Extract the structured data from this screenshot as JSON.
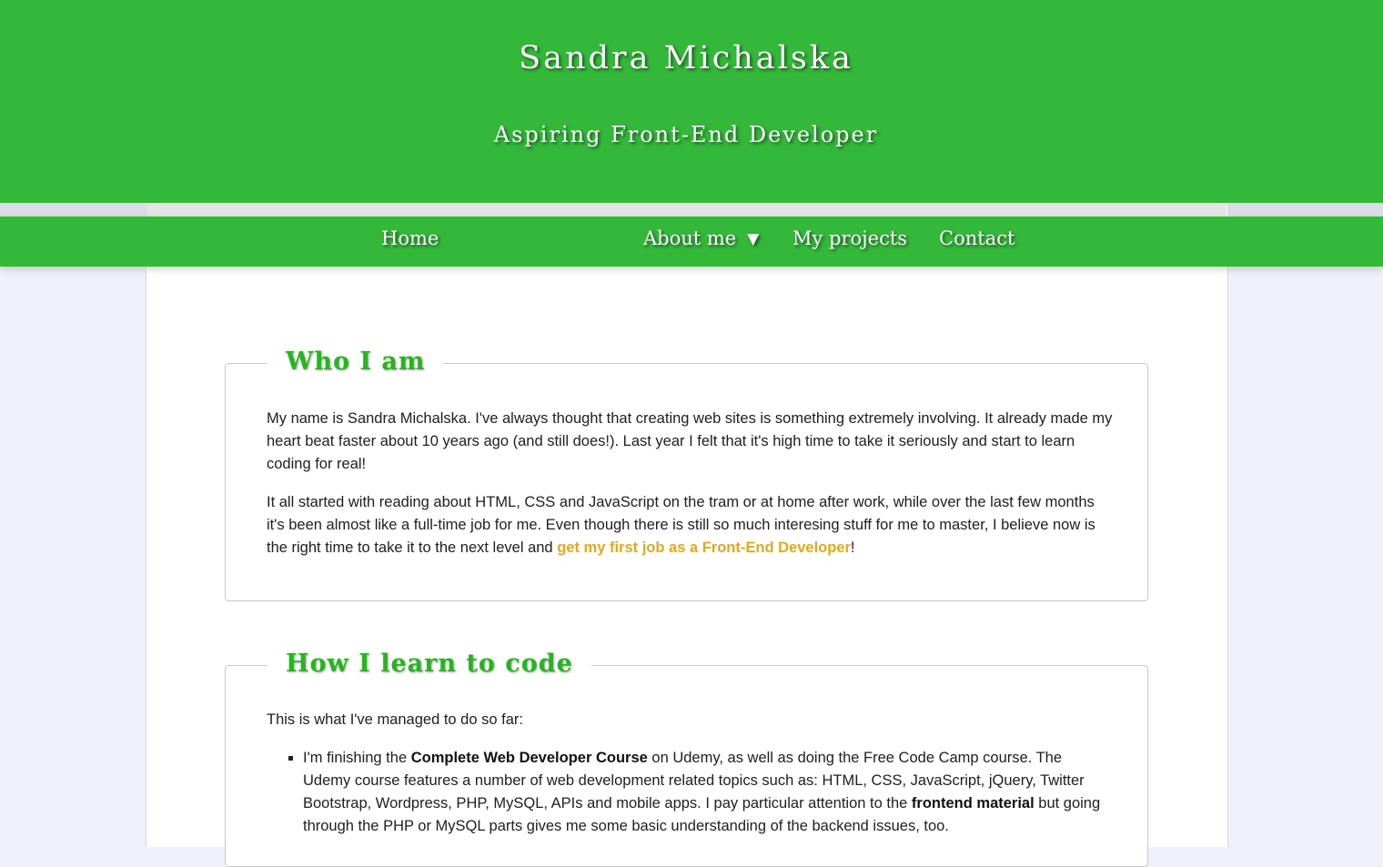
{
  "header": {
    "title": "Sandra Michalska",
    "subtitle": "Aspiring Front-End Developer"
  },
  "nav": {
    "items": [
      {
        "label": "Home"
      },
      {
        "label": "About me",
        "caret": "▼"
      },
      {
        "label": "My projects"
      },
      {
        "label": "Contact"
      }
    ]
  },
  "who_i_am": {
    "heading": "Who I am",
    "p1": "My name is Sandra Michalska. I've always thought that creating web sites is something extremely involving. It already made my heart beat faster about 10 years ago (and still does!). Last year I felt that it's high time to take it seriously and start to learn coding for real!",
    "p2_before": "It all started with reading about HTML, CSS and JavaScript on the tram or at home after work, while over the last few months it's been almost like a full-time job for me. Even though there is still so much interesing stuff for me to master, I believe now is the right time to take it to the next level and ",
    "p2_link": "get my first job as a Front-End Developer",
    "p2_after": "!"
  },
  "how_i_learn": {
    "heading": "How I learn to code",
    "intro": "This is what I've managed to do so far:",
    "bullet1": {
      "t1": "I'm finishing the ",
      "b1": "Complete Web Developer Course",
      "t2": " on Udemy, as well as doing the Free Code Camp course. The Udemy course features a number of web development related topics such as: HTML, CSS, JavaScript, jQuery, Twitter Bootstrap, Wordpress, PHP, MySQL, APIs and mobile apps. I pay particular attention to the ",
      "b2": "frontend material",
      "t3": " but going through the PHP or MySQL parts gives me some basic understanding of the backend issues, too."
    }
  },
  "colors": {
    "brand_green": "#33b83a",
    "heading_green": "#27b51f",
    "link_orange": "#e5a81c",
    "page_background": "#eff0f9"
  }
}
